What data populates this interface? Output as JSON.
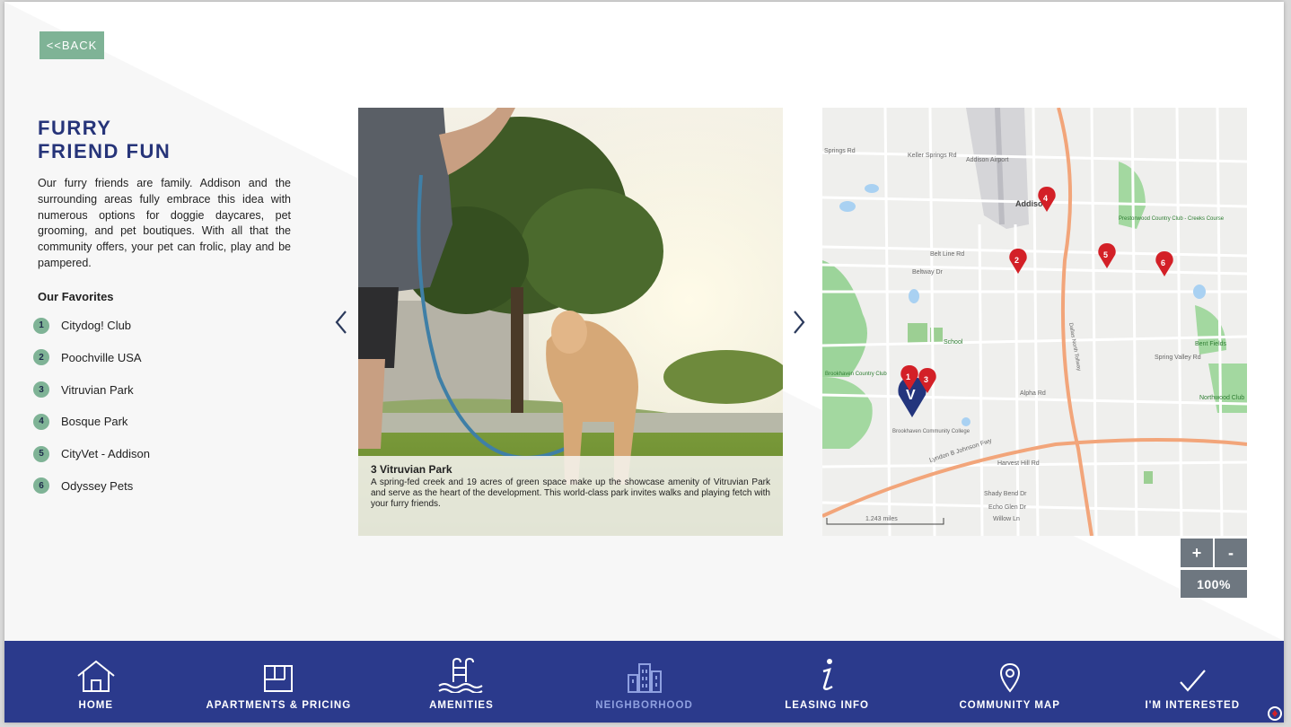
{
  "back_label": "<<BACK",
  "section": {
    "title_line1": "FURRY",
    "title_line2": "FRIEND FUN",
    "intro": "Our furry friends are family. Addison and the surrounding areas fully embrace this idea with numerous options for doggie daycares, pet grooming, and pet boutiques. With all that the community offers, your pet can frolic, play and be pampered.",
    "favorites_heading": "Our Favorites",
    "favorites": [
      {
        "num": "1",
        "label": "Citydog! Club"
      },
      {
        "num": "2",
        "label": "Poochville USA"
      },
      {
        "num": "3",
        "label": "Vitruvian Park"
      },
      {
        "num": "4",
        "label": "Bosque Park"
      },
      {
        "num": "5",
        "label": "CityVet - Addison"
      },
      {
        "num": "6",
        "label": "Odyssey Pets"
      }
    ]
  },
  "photo": {
    "caption_title": "3 Vitruvian Park",
    "caption_text": "A spring-fed creek and 19 acres of green space make up the showcase amenity of Vitruvian Park and serve as the heart of the development. This world-class park invites walks and playing fetch with your furry friends."
  },
  "map": {
    "labels": {
      "airport": "Addison Airport",
      "town": "Addison",
      "country_club": "Brookhaven Country Club",
      "college": "Brookhaven Community College",
      "scale": "1.243 miles",
      "springs": "Springs Rd",
      "keller": "Keller Springs Rd",
      "belt_line": "Belt Line Rd",
      "beltway": "Beltway Dr",
      "spring_valley": "Spring Valley Rd",
      "alpha": "Alpha Rd",
      "harvest": "Harvest Hill Rd",
      "lbj": "Lyndon B Johnson Fwy",
      "shady": "Shady Bend Dr",
      "echo": "Echo Glen Dr",
      "willow": "Willow Ln",
      "prestonwood": "Prestonwood Country Club - Creeks Course",
      "bent": "Bent Fields",
      "northwood": "Northwood Club",
      "school": "School",
      "dallas_pkwy": "Dallas North Tollway"
    },
    "markers": [
      "1",
      "2",
      "3",
      "4",
      "5",
      "6"
    ],
    "zoom_in": "+",
    "zoom_out": "-",
    "zoom_level": "100%"
  },
  "nav": {
    "items": [
      {
        "label": "HOME",
        "icon": "home-icon"
      },
      {
        "label": "APARTMENTS & PRICING",
        "icon": "floorplan-icon"
      },
      {
        "label": "AMENITIES",
        "icon": "pool-icon"
      },
      {
        "label": "NEIGHBORHOOD",
        "icon": "buildings-icon"
      },
      {
        "label": "LEASING INFO",
        "icon": "info-icon"
      },
      {
        "label": "COMMUNITY MAP",
        "icon": "location-pin-icon"
      },
      {
        "label": "I'M INTERESTED",
        "icon": "checkmark-icon"
      }
    ],
    "active": "NEIGHBORHOOD"
  },
  "colors": {
    "brand_blue": "#2b3a8c",
    "title_blue": "#263479",
    "accent_green": "#7fb396",
    "marker_red": "#d32027",
    "zoom_gray": "#6e7780",
    "active_nav": "#8fa0e0"
  }
}
